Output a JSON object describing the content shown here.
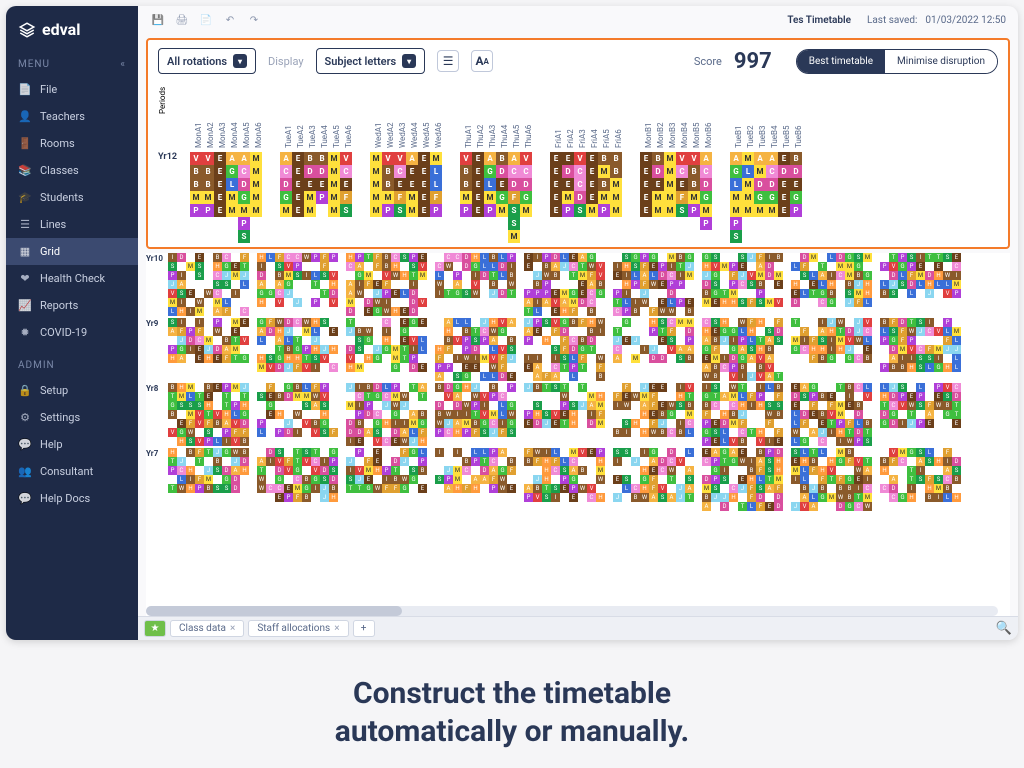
{
  "app": {
    "name": "edval"
  },
  "topbar": {
    "title": "Tes Timetable",
    "last_saved_label": "Last saved:",
    "last_saved_value": "01/03/2022 12:50"
  },
  "sidebar": {
    "menu_label": "MENU",
    "admin_label": "ADMIN",
    "items": [
      {
        "icon": "📄",
        "label": "File"
      },
      {
        "icon": "👤",
        "label": "Teachers"
      },
      {
        "icon": "🚪",
        "label": "Rooms"
      },
      {
        "icon": "📚",
        "label": "Classes"
      },
      {
        "icon": "🎓",
        "label": "Students"
      },
      {
        "icon": "☰",
        "label": "Lines"
      },
      {
        "icon": "▦",
        "label": "Grid"
      },
      {
        "icon": "❤",
        "label": "Health Check"
      },
      {
        "icon": "📈",
        "label": "Reports"
      },
      {
        "icon": "✹",
        "label": "COVID-19"
      }
    ],
    "admin_items": [
      {
        "icon": "🔒",
        "label": "Setup"
      },
      {
        "icon": "⚙",
        "label": "Settings"
      },
      {
        "icon": "💬",
        "label": "Help"
      },
      {
        "icon": "👥",
        "label": "Consultant"
      },
      {
        "icon": "💬",
        "label": "Help Docs"
      }
    ],
    "active": "Grid"
  },
  "controls": {
    "rotation_label": "All rotations",
    "display_label": "Display",
    "subject_label": "Subject letters",
    "score_label": "Score",
    "score_value": "997",
    "seg_best": "Best timetable",
    "seg_min": "Minimise disruption"
  },
  "days": [
    "MonA",
    "TueA",
    "WedA",
    "ThuA",
    "FriA",
    "MonB",
    "TueB"
  ],
  "periods_per_day": 6,
  "periods_label": "Periods",
  "year12_label": "Yr12",
  "year12_grid": {
    "days": [
      [
        [
          "V",
          "V",
          "E",
          "A",
          "A",
          "M"
        ],
        [
          "B",
          "B",
          "E",
          "G",
          "C",
          "M"
        ],
        [
          "B",
          "B",
          "E",
          "L",
          "D",
          "M"
        ],
        [
          "M",
          "M",
          "E",
          "M",
          "G",
          "M"
        ],
        [
          "P",
          "P",
          "E",
          "M",
          "M",
          "M"
        ],
        [
          "",
          "",
          "",
          "",
          "P",
          ""
        ],
        [
          "",
          "",
          "",
          "",
          "S",
          ""
        ]
      ],
      [
        [
          "A",
          "E",
          "B",
          "B",
          "M",
          "V"
        ],
        [
          "C",
          "E",
          "D",
          "D",
          "M",
          "C"
        ],
        [
          "D",
          "E",
          "E",
          "E",
          "M",
          "E"
        ],
        [
          "G",
          "E",
          "M",
          "P",
          "M",
          "F"
        ],
        [
          "M",
          "E",
          "M",
          "",
          "M",
          "S"
        ]
      ],
      [
        [
          "M",
          "V",
          "V",
          "A",
          "E",
          "M"
        ],
        [
          "M",
          "B",
          "C",
          "E",
          "E",
          "L"
        ],
        [
          "M",
          "B",
          "E",
          "E",
          "E",
          "L"
        ],
        [
          "M",
          "M",
          "F",
          "M",
          "E",
          "F"
        ],
        [
          "M",
          "P",
          "S",
          "M",
          "E",
          "P"
        ]
      ],
      [
        [
          "V",
          "E",
          "A",
          "B",
          "A",
          "V"
        ],
        [
          "B",
          "E",
          "G",
          "D",
          "C",
          "C"
        ],
        [
          "B",
          "E",
          "L",
          "E",
          "D",
          "D"
        ],
        [
          "M",
          "E",
          "M",
          "G",
          "F",
          "G"
        ],
        [
          "P",
          "E",
          "P",
          "M",
          "S",
          "M"
        ],
        [
          "",
          "",
          "",
          "",
          "S",
          ""
        ],
        [
          "",
          "",
          "",
          "",
          "M",
          ""
        ]
      ],
      [
        [
          "E",
          "E",
          "V",
          "E",
          "B",
          "B"
        ],
        [
          "E",
          "D",
          "C",
          "E",
          "M",
          "B",
          "G"
        ],
        [
          "E",
          "E",
          "C",
          "E",
          "B",
          "M",
          "L"
        ],
        [
          "E",
          "M",
          "D",
          "E",
          "M",
          "M",
          "M"
        ],
        [
          "E",
          "P",
          "S",
          "M",
          "P",
          "M"
        ]
      ],
      [
        [
          "E",
          "B",
          "M",
          "V",
          "V",
          "A"
        ],
        [
          "E",
          "D",
          "M",
          "C",
          "B",
          "C"
        ],
        [
          "E",
          "E",
          "M",
          "E",
          "B",
          "D"
        ],
        [
          "E",
          "M",
          "M",
          "F",
          "M",
          "G"
        ],
        [
          "E",
          "M",
          "M",
          "S",
          "P",
          "M"
        ],
        [
          "",
          "",
          "",
          "",
          "",
          "P"
        ]
      ],
      [
        [
          "A",
          "M",
          "A",
          "A",
          "E",
          "B"
        ],
        [
          "G",
          "L",
          "M",
          "C",
          "D",
          "D",
          "E"
        ],
        [
          "L",
          "M",
          "D",
          "D",
          "E",
          "E"
        ],
        [
          "M",
          "M",
          "G",
          "G",
          "E",
          "G"
        ],
        [
          "M",
          "M",
          "M",
          "M",
          "E",
          "P"
        ],
        [
          "P",
          "",
          "",
          "",
          "",
          ""
        ],
        [
          "S",
          "",
          "",
          "",
          "",
          ""
        ]
      ]
    ]
  },
  "lower_years": [
    "Yr10",
    "Yr9",
    "Yr8",
    "Yr7"
  ],
  "tabs": {
    "class_data": "Class data",
    "staff_alloc": "Staff allocations"
  },
  "caption_line1": "Construct the timetable",
  "caption_line2": "automatically or manually.",
  "subject_colors": {
    "A": "#f5b342",
    "B": "#8a5a2b",
    "C": "#f08ad6",
    "D": "#d94f9e",
    "E": "#6b3f1a",
    "F": "#e0a030",
    "G": "#3fbf3f",
    "H": "#ff9a3c",
    "I": "#8a5a2b",
    "J": "#8ad6f0",
    "L": "#3a6fd8",
    "M": "#ffe03c",
    "P": "#b03fd8",
    "S": "#1a9e4a",
    "T": "#3fbf3f",
    "V": "#e03f3f",
    "W": "#8a5a2b"
  }
}
